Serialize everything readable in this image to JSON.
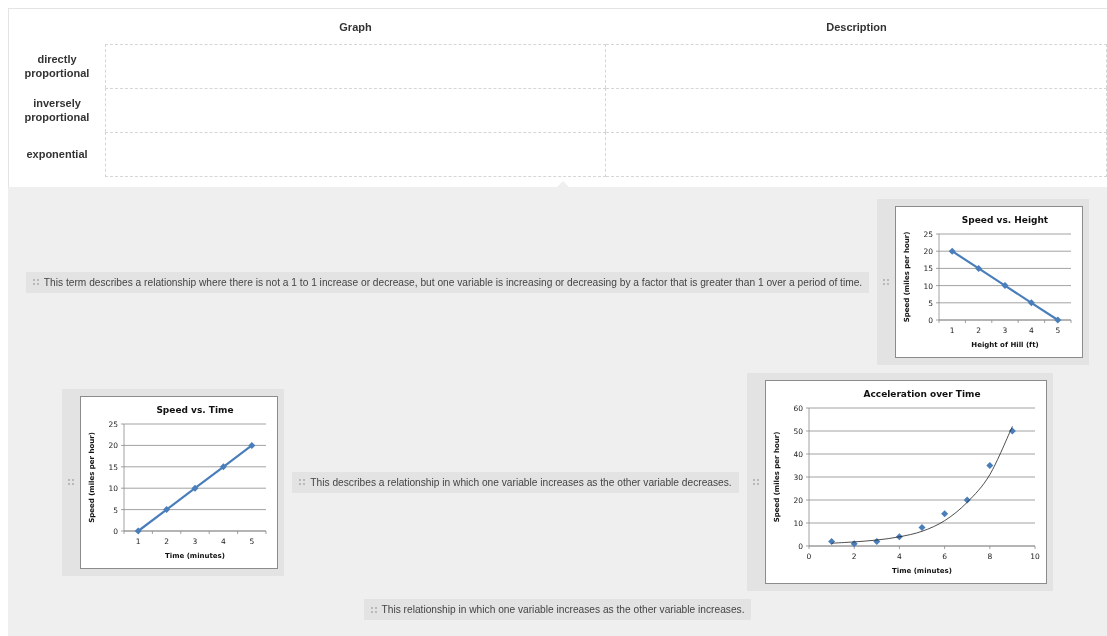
{
  "table": {
    "columns": [
      "Graph",
      "Description"
    ],
    "rows": [
      {
        "label": "directly proportional"
      },
      {
        "label": "inversely proportional"
      },
      {
        "label": "exponential"
      }
    ]
  },
  "tray": [
    {
      "kind": "text",
      "text": "This term describes a relationship where there is not a 1 to 1 increase or decrease, but one variable is increasing or decreasing by a factor that is greater than 1 over a period of time."
    },
    {
      "kind": "chart",
      "chart_data": {
        "type": "line",
        "title": "Speed vs. Height",
        "xlabel": "Height of Hill (ft)",
        "ylabel": "Speed (miles per hour)",
        "categories": [
          "1",
          "2",
          "3",
          "4",
          "5"
        ],
        "series": [
          {
            "color": "#4a7ebb",
            "marker": "diamond",
            "values": [
              20,
              15,
              10,
              5,
              0
            ]
          }
        ],
        "grid": true,
        "ylim": [
          0,
          25
        ],
        "yticks": [
          0,
          5,
          10,
          15,
          20,
          25
        ]
      }
    },
    {
      "kind": "chart",
      "chart_data": {
        "type": "line",
        "title": "Speed vs. Time",
        "xlabel": "Time (minutes)",
        "ylabel": "Speed (miles per hour)",
        "categories": [
          "1",
          "2",
          "3",
          "4",
          "5"
        ],
        "series": [
          {
            "color": "#4a7ebb",
            "marker": "diamond",
            "values": [
              0,
              5,
              10,
              15,
              20
            ]
          }
        ],
        "grid": true,
        "ylim": [
          0,
          25
        ],
        "yticks": [
          0,
          5,
          10,
          15,
          20,
          25
        ]
      }
    },
    {
      "kind": "text",
      "text": "This describes a relationship in which one variable increases as the other variable decreases."
    },
    {
      "kind": "chart",
      "chart_data": {
        "type": "scatter",
        "title": "Acceleration over Time",
        "xlabel": "Time (minutes)",
        "ylabel": "Speed (miles per hour)",
        "x": [
          1,
          2,
          3,
          4,
          5,
          6,
          7,
          8,
          9
        ],
        "series": [
          {
            "color": "#4a7ebb",
            "marker": "diamond",
            "values": [
              2,
              1,
              2,
              4,
              8,
              14,
              20,
              35,
              50
            ]
          },
          {
            "type": "line",
            "color": "#222222",
            "values": [
              1.2,
              1.8,
              2.6,
              4,
              6.4,
              11,
              19,
              31,
              52
            ]
          }
        ],
        "grid": true,
        "xlim": [
          0,
          10
        ],
        "ylim": [
          0,
          60
        ],
        "xticks": [
          0,
          2,
          4,
          6,
          8,
          10
        ],
        "yticks": [
          0,
          10,
          20,
          30,
          40,
          50,
          60
        ]
      }
    },
    {
      "kind": "text",
      "text": "This relationship in which one variable increases as the other variable increases."
    }
  ]
}
